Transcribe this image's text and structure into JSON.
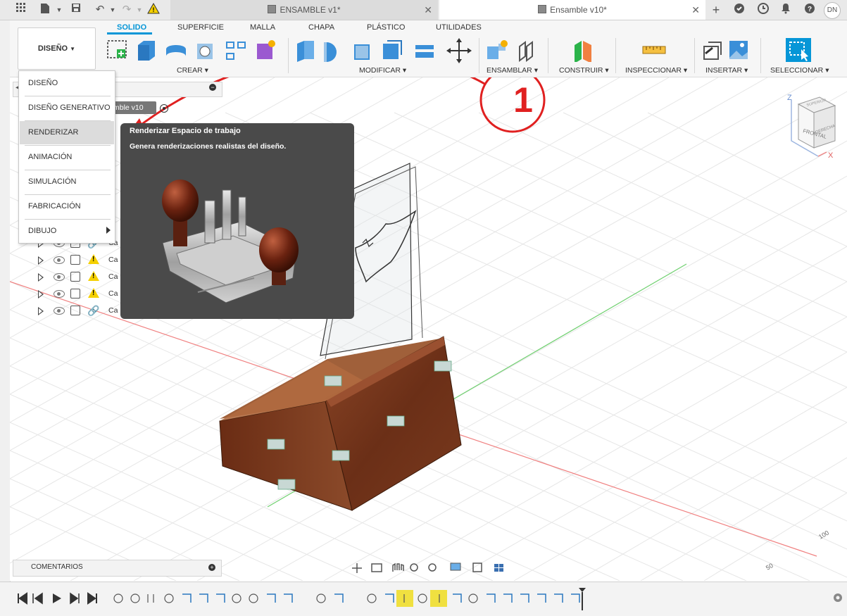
{
  "tabs": [
    {
      "label": "ENSAMBLE v1*"
    },
    {
      "label": "Ensamble v10*"
    }
  ],
  "user_initials": "DN",
  "workspace_button": "DISEÑO",
  "ribbon_tabs": [
    "SOLIDO",
    "SUPERFICIE",
    "MALLA",
    "CHAPA",
    "PLÁSTICO",
    "UTILIDADES"
  ],
  "ribbon_groups": {
    "crear": "CREAR",
    "modificar": "MODIFICAR",
    "ensamblar": "ENSAMBLAR",
    "construir": "CONSTRUIR",
    "inspeccionar": "INSPECCIONAR",
    "insertar": "INSERTAR",
    "seleccionar": "SELECCIONAR"
  },
  "workspace_menu": [
    {
      "label": "DISEÑO"
    },
    {
      "label": "DISEÑO GENERATIVO"
    },
    {
      "label": "RENDERIZAR"
    },
    {
      "label": "ANIMACIÓN"
    },
    {
      "label": "SIMULACIÓN"
    },
    {
      "label": "FABRICACIÓN"
    },
    {
      "label": "DIBUJO"
    }
  ],
  "tooltip": {
    "title": "Renderizar Espacio de trabajo",
    "description": "Genera renderizaciones realistas del diseño."
  },
  "browser": {
    "root_label": "mble v10",
    "rows": [
      "Ca",
      "Ca",
      "Ca",
      "Ca",
      "Ca"
    ]
  },
  "annotation": {
    "number": "1",
    "color": "#e02020"
  },
  "viewcube": {
    "front": "FRONTAL",
    "right": "DERECHA",
    "top": "SUPERIOR",
    "axis_z": "Z",
    "axis_x": "X"
  },
  "grid_labels": [
    "100",
    "50"
  ],
  "comments_label": "COMENTARIOS",
  "colors": {
    "accent": "#0696d7",
    "annotation": "#e02020",
    "wood": "#7a3a1e"
  }
}
